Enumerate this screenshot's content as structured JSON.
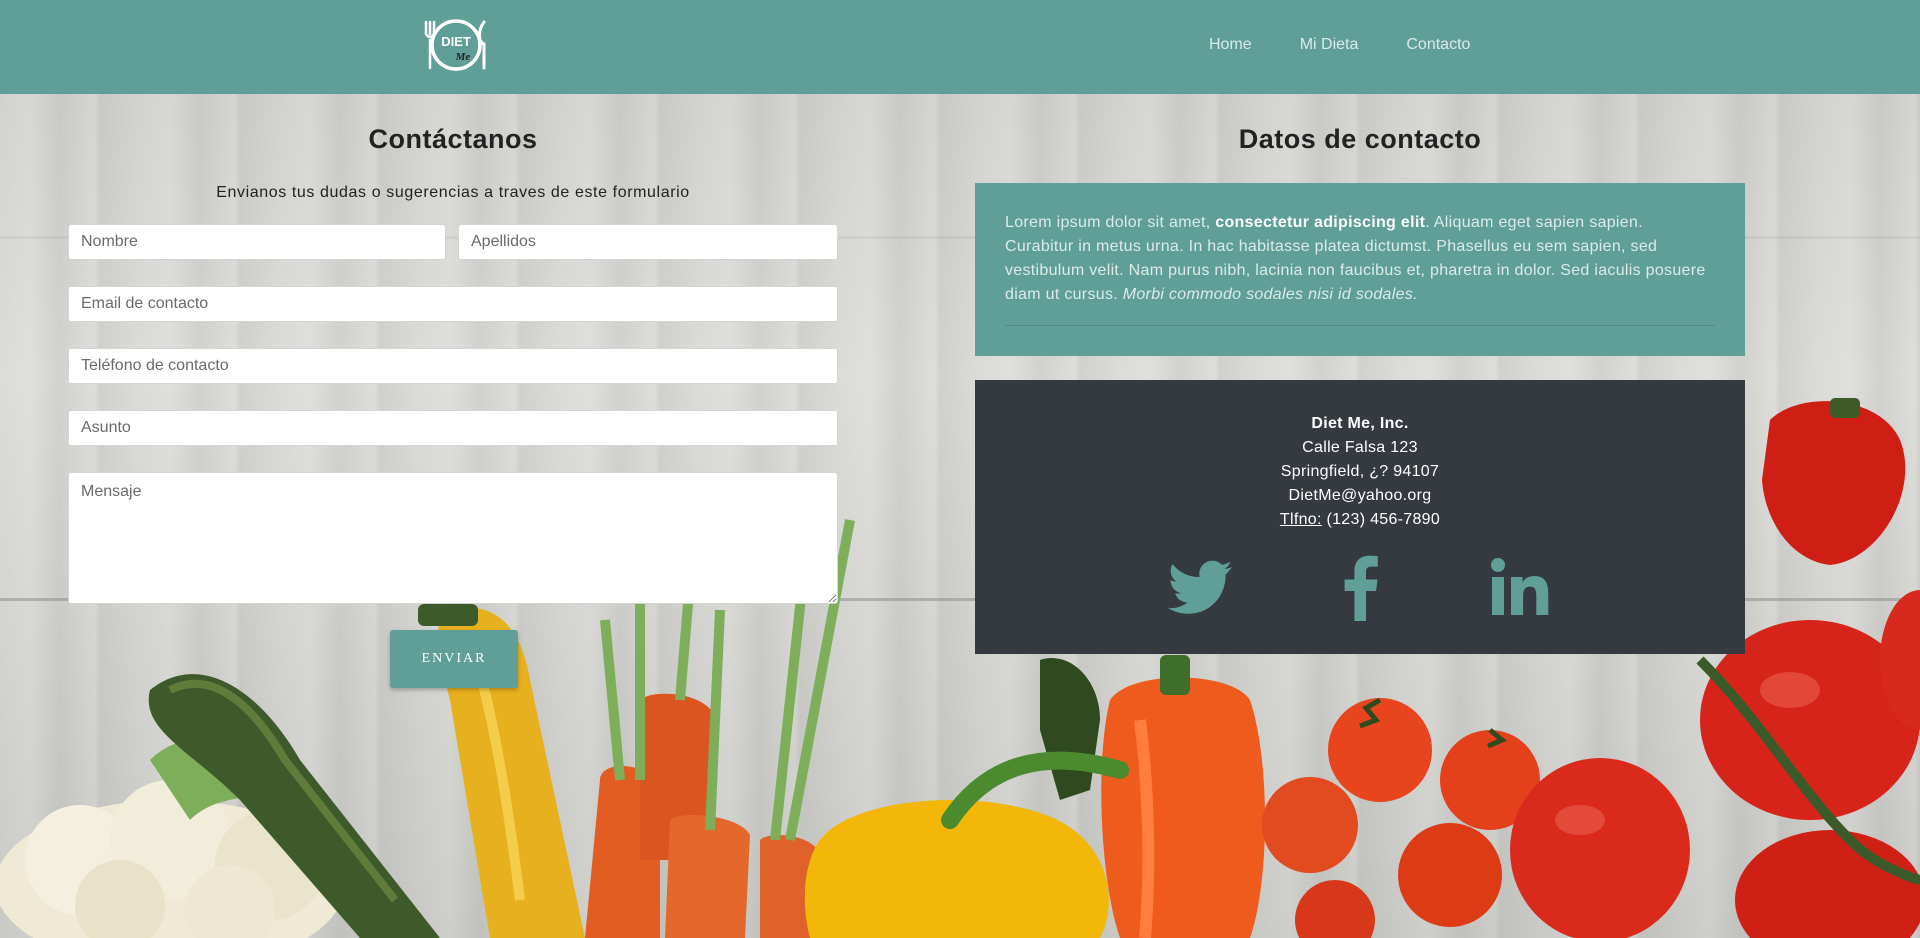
{
  "header": {
    "logo_text_top": "DIET",
    "logo_text_bottom": "Me",
    "nav": [
      {
        "label": "Home"
      },
      {
        "label": "Mi Dieta"
      },
      {
        "label": "Contacto"
      }
    ]
  },
  "form": {
    "title": "Contáctanos",
    "subtitle": "Envianos tus dudas o sugerencias a traves de este formulario",
    "fields": {
      "nombre": {
        "placeholder": "Nombre",
        "value": ""
      },
      "apellidos": {
        "placeholder": "Apellidos",
        "value": ""
      },
      "email": {
        "placeholder": "Email de contacto",
        "value": ""
      },
      "telefono": {
        "placeholder": "Teléfono de contacto",
        "value": ""
      },
      "asunto": {
        "placeholder": "Asunto",
        "value": ""
      },
      "mensaje": {
        "placeholder": "Mensaje",
        "value": ""
      }
    },
    "submit_label": "ENVIAR"
  },
  "contact": {
    "title": "Datos de contacto",
    "blurb": {
      "part1": "Lorem ipsum dolor sit amet, ",
      "bold": "consectetur adipiscing elit",
      "part2": ". Aliquam eget sapien sapien. Curabitur in metus urna. In hac habitasse platea dictumst. Phasellus eu sem sapien, sed vestibulum velit. Nam purus nibh, lacinia non faucibus et, pharetra in dolor. Sed iaculis posuere diam ut cursus. ",
      "italic": "Morbi commodo sodales nisi id sodales."
    },
    "address": {
      "company": "Diet Me, Inc.",
      "street": "Calle Falsa 123",
      "city": "Springfield, ¿? 94107",
      "email": "DietMe@yahoo.org",
      "phone_label": "Tlfno:",
      "phone": "(123) 456-7890"
    },
    "social": [
      {
        "icon": "twitter-icon"
      },
      {
        "icon": "facebook-icon"
      },
      {
        "icon": "linkedin-icon"
      }
    ]
  },
  "colors": {
    "accent": "#5f9f98",
    "dark_panel": "#343a40",
    "nav_text": "#dbe9e7"
  }
}
